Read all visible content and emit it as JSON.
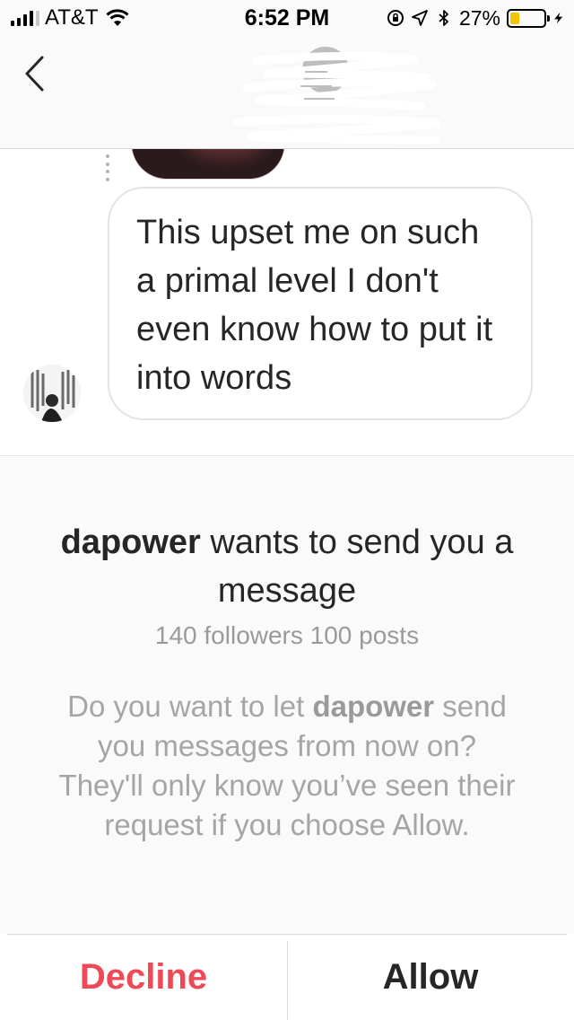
{
  "status_bar": {
    "carrier": "AT&T",
    "time": "6:52 PM",
    "battery_percent": "27%",
    "battery_level": 0.27,
    "icons": [
      "signal-icon",
      "wifi-icon",
      "orientation-lock-icon",
      "location-icon",
      "bluetooth-icon",
      "battery-icon",
      "charging-icon"
    ]
  },
  "header": {
    "back_icon": "chevron-left-icon"
  },
  "chat": {
    "message": "This upset me on such a primal level I don't even know how to put it into words"
  },
  "request": {
    "username": "dapower",
    "title_suffix": " wants to send you a message",
    "stats": "140 followers 100 posts",
    "body_prefix": "Do you want to let ",
    "body_username": "dapower",
    "body_suffix": " send you messages from now on? They'll only know you’ve seen their request if you choose Allow."
  },
  "actions": {
    "decline_label": "Decline",
    "allow_label": "Allow"
  },
  "colors": {
    "decline": "#ed4956",
    "allow": "#262626",
    "battery_fill": "#f5c400"
  }
}
